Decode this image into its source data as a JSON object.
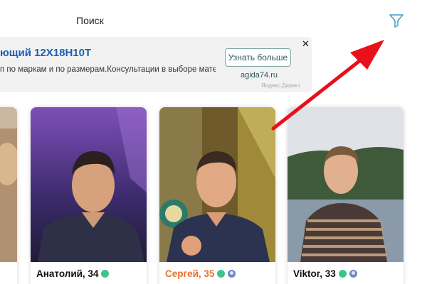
{
  "header": {
    "title": "Поиск"
  },
  "ad": {
    "title": "ющий 12Х18Н10Т",
    "description": "п по маркам и по размерам.Консультации в выборе мате-",
    "button_label": "Узнать больше",
    "domain": "agida74.ru",
    "close": "✕",
    "source": "Яндекс.Директ"
  },
  "cards": [
    {
      "name": "Анатолий, 34",
      "online": true,
      "verified": false,
      "highlight": false,
      "sub": ""
    },
    {
      "name": "Сергей, 35",
      "online": true,
      "verified": true,
      "highlight": true,
      "sub": ""
    },
    {
      "name": "Viktor, 33",
      "online": true,
      "verified": true,
      "highlight": false,
      "sub": ""
    }
  ],
  "colors": {
    "online": "#3cc48a",
    "verified": "#6e86cf",
    "highlight_name": "#e8702a",
    "ad_title": "#1a5fb4",
    "arrow": "#e8101a",
    "filter_icon": "#3aa0c8"
  },
  "icons": {
    "filter": "filter-icon",
    "arrow": "red-arrow-annotation"
  }
}
